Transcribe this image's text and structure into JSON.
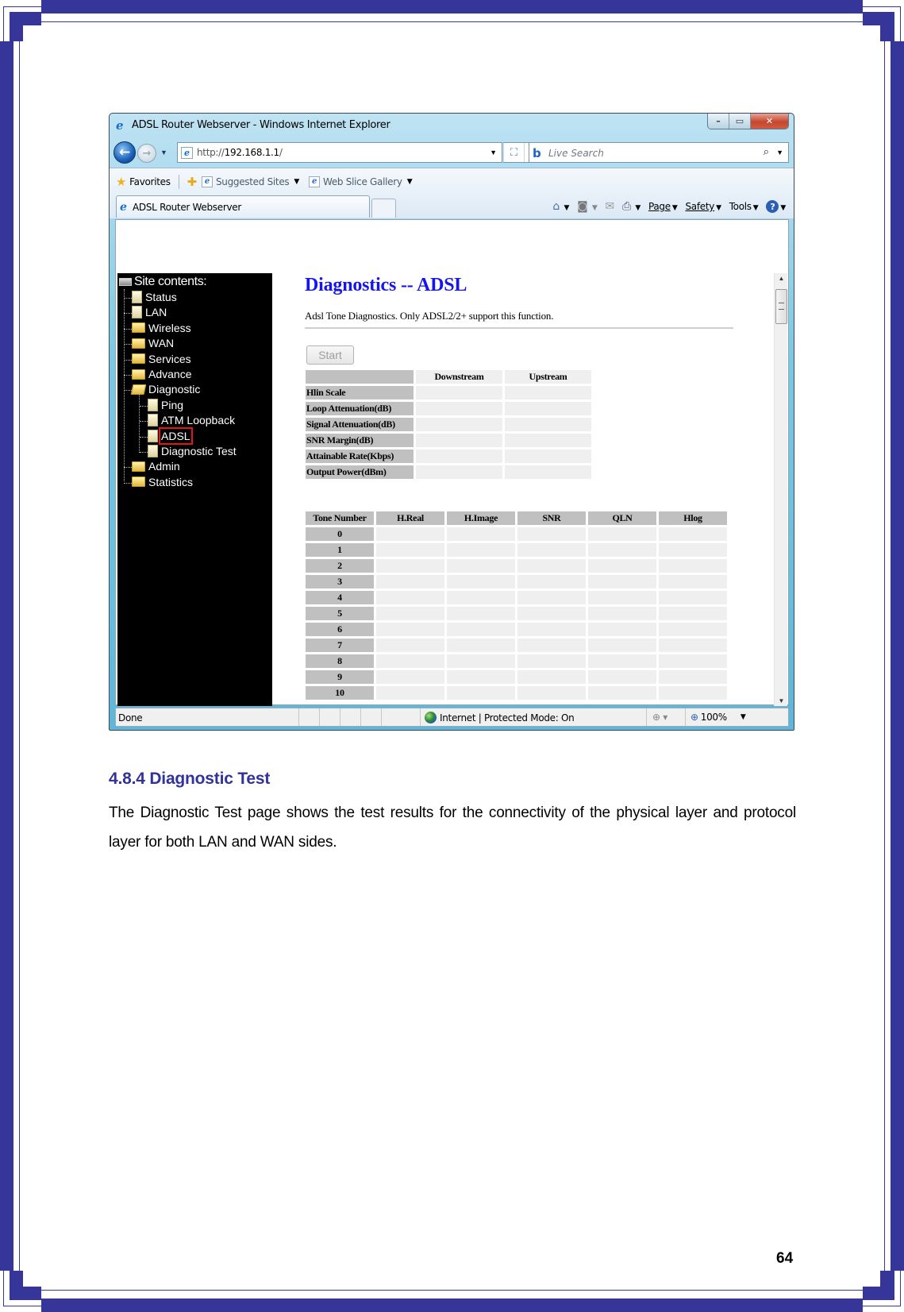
{
  "browser": {
    "window_title": "ADSL Router Webserver - Windows Internet Explorer",
    "window_buttons": {
      "minimize": "–",
      "maximize": "▭",
      "close": "✕"
    },
    "address": {
      "scheme": "http://",
      "host": "192.168.1.1",
      "path": "/"
    },
    "search_placeholder": "Live Search",
    "favorites_bar": {
      "favorites_label": "Favorites",
      "links": [
        {
          "label": "Suggested Sites"
        },
        {
          "label": "Web Slice Gallery"
        }
      ]
    },
    "tab_label": "ADSL Router Webserver",
    "command_bar": {
      "page": "Page",
      "safety": "Safety",
      "tools": "Tools",
      "help": "?"
    },
    "status": {
      "text": "Done",
      "zone": "Internet | Protected Mode: On",
      "zoom": "100%"
    }
  },
  "sidebar": {
    "root_label": "Site contents:",
    "items": [
      {
        "label": "Status",
        "type": "doc",
        "level": 0
      },
      {
        "label": "LAN",
        "type": "doc",
        "level": 0
      },
      {
        "label": "Wireless",
        "type": "folder",
        "level": 0
      },
      {
        "label": "WAN",
        "type": "folder",
        "level": 0
      },
      {
        "label": "Services",
        "type": "folder",
        "level": 0
      },
      {
        "label": "Advance",
        "type": "folder",
        "level": 0
      },
      {
        "label": "Diagnostic",
        "type": "folder-open",
        "level": 0
      },
      {
        "label": "Ping",
        "type": "doc",
        "level": 1
      },
      {
        "label": "ATM Loopback",
        "type": "doc",
        "level": 1
      },
      {
        "label": "ADSL",
        "type": "doc",
        "level": 1,
        "selected": true
      },
      {
        "label": "Diagnostic Test",
        "type": "doc",
        "level": 1
      },
      {
        "label": "Admin",
        "type": "folder",
        "level": 0
      },
      {
        "label": "Statistics",
        "type": "folder",
        "level": 0
      }
    ]
  },
  "main": {
    "title": "Diagnostics -- ADSL",
    "description": "Adsl Tone Diagnostics. Only ADSL2/2+ support this function.",
    "start_button": "Start",
    "summary_table": {
      "columns": [
        "",
        "Downstream",
        "Upstream"
      ],
      "rows": [
        {
          "label": "Hlin Scale",
          "downstream": "",
          "upstream": ""
        },
        {
          "label": "Loop Attenuation(dB)",
          "downstream": "",
          "upstream": ""
        },
        {
          "label": "Signal Attenuation(dB)",
          "downstream": "",
          "upstream": ""
        },
        {
          "label": "SNR Margin(dB)",
          "downstream": "",
          "upstream": ""
        },
        {
          "label": "Attainable Rate(Kbps)",
          "downstream": "",
          "upstream": ""
        },
        {
          "label": "Output Power(dBm)",
          "downstream": "",
          "upstream": ""
        }
      ]
    },
    "tone_table": {
      "columns": [
        "Tone Number",
        "H.Real",
        "H.Image",
        "SNR",
        "QLN",
        "Hlog"
      ],
      "tones": [
        "0",
        "1",
        "2",
        "3",
        "4",
        "5",
        "6",
        "7",
        "8",
        "9",
        "10"
      ]
    }
  },
  "document": {
    "section_title": "4.8.4 Diagnostic Test",
    "paragraph": "The Diagnostic Test page shows the test results for the connectivity of the physical layer and protocol layer for both LAN and WAN sides.",
    "page_number": "64"
  },
  "colors": {
    "frame": "#36369a",
    "heading_blue": "#1515ee",
    "section_title": "#32329b",
    "selection_box": "#e0161d"
  }
}
